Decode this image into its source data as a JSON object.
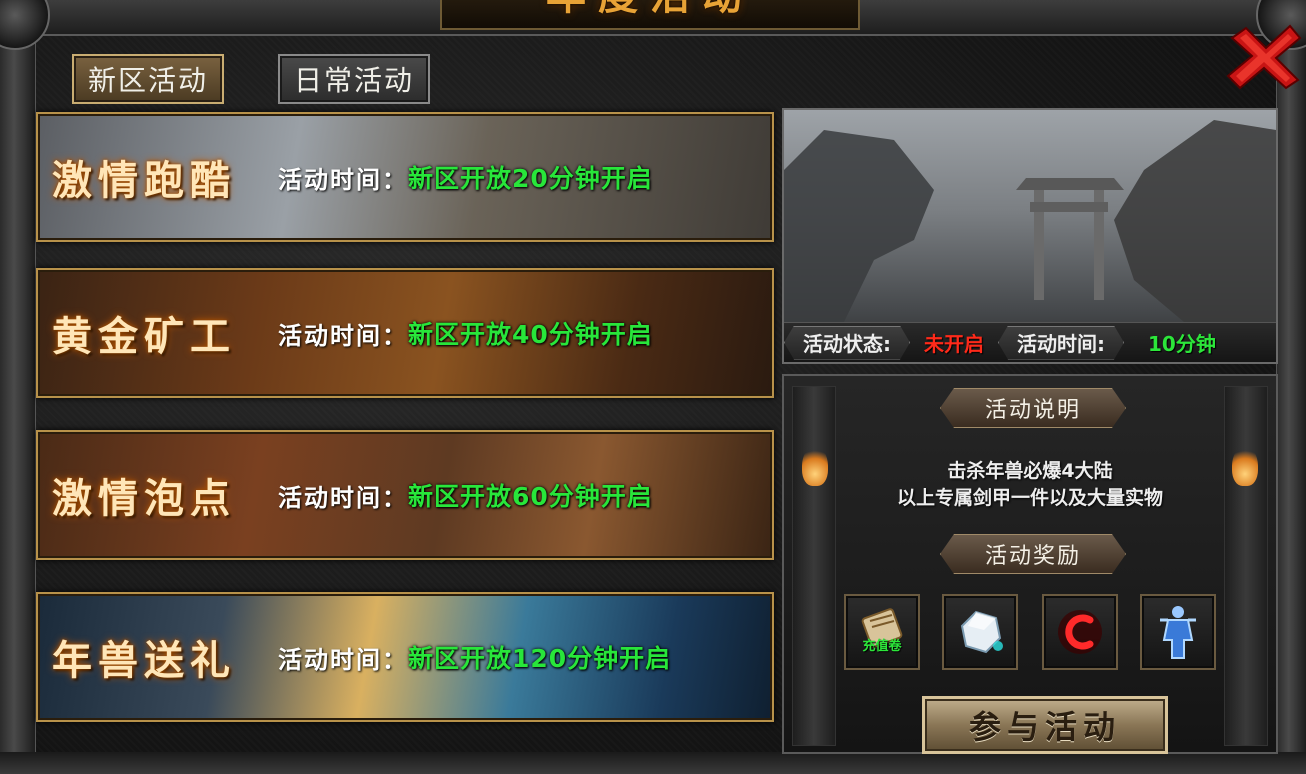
{
  "window": {
    "title": "年度活动"
  },
  "tabs": [
    {
      "label": "新区活动",
      "active": true
    },
    {
      "label": "日常活动",
      "active": false
    }
  ],
  "events": [
    {
      "name": "激情跑酷",
      "time_label": "活动时间：",
      "time_value": "新区开放20分钟开启"
    },
    {
      "name": "黄金矿工",
      "time_label": "活动时间：",
      "time_value": "新区开放40分钟开启"
    },
    {
      "name": "激情泡点",
      "time_label": "活动时间：",
      "time_value": "新区开放60分钟开启"
    },
    {
      "name": "年兽送礼",
      "time_label": "活动时间：",
      "time_value": "新区开放120分钟开启"
    }
  ],
  "detail": {
    "status_label": "活动状态:",
    "status_value": "未开启",
    "time_label": "活动时间:",
    "time_value": "10分钟",
    "description_title": "活动说明",
    "description_lines": [
      "击杀年兽必爆4大陆",
      "以上专属剑甲一件以及大量实物"
    ],
    "reward_title": "活动奖励",
    "rewards": [
      {
        "icon": "scroll-icon",
        "label": "充值卷"
      },
      {
        "icon": "crystal-icon"
      },
      {
        "icon": "red-ring-icon"
      },
      {
        "icon": "armor-figure-icon"
      }
    ],
    "join_label": "参与活动"
  },
  "colors": {
    "accent_gold": "#b8924a",
    "time_green": "#28e63a",
    "status_red": "#ff2a1a"
  }
}
